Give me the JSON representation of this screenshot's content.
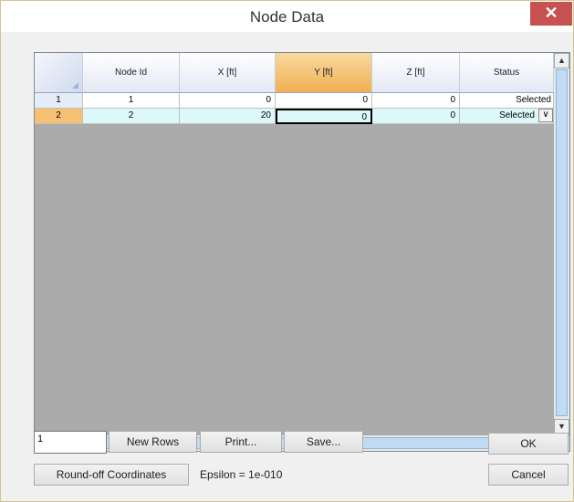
{
  "window": {
    "title": "Node Data",
    "close_label": "✕"
  },
  "grid": {
    "columns": [
      "Node Id",
      "X [ft]",
      "Y [ft]",
      "Z [ft]",
      "Status"
    ],
    "selected_column": "Y [ft]",
    "rows": [
      {
        "row_label": "1",
        "node_id": "1",
        "x": "0",
        "y": "0",
        "z": "0",
        "status": "Selected"
      },
      {
        "row_label": "2",
        "node_id": "2",
        "x": "20",
        "y": "0",
        "z": "0",
        "status": "Selected"
      }
    ],
    "status_dropdown_icon": "chevron-down-icon"
  },
  "controls": {
    "rows_value": "1",
    "new_rows_label": "New Rows",
    "print_label": "Print...",
    "save_label": "Save...",
    "ok_label": "OK",
    "round_off_label": "Round-off Coordinates",
    "epsilon_label": "Epsilon = 1e-010",
    "cancel_label": "Cancel"
  },
  "colors": {
    "selected_header": "#f0b050",
    "row_highlight": "#dcf8f8",
    "close_button": "#c75050"
  }
}
